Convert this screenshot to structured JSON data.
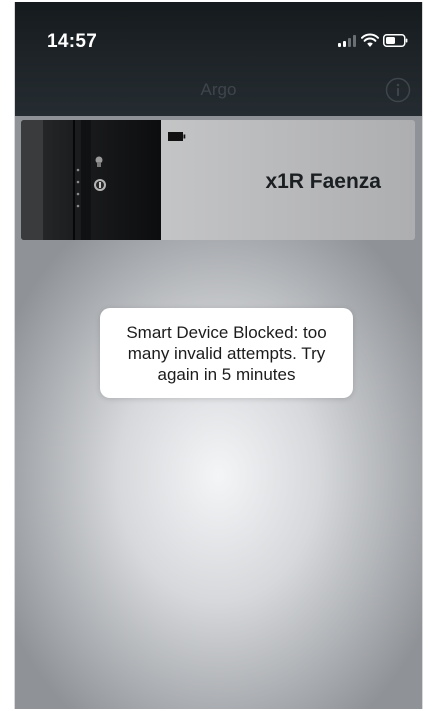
{
  "status_bar": {
    "time": "14:57",
    "signal_icon": "cellular-signal-icon",
    "wifi_icon": "wifi-icon",
    "battery_icon": "battery-icon"
  },
  "nav": {
    "title": "Argo",
    "info_icon": "info-circle-icon"
  },
  "device": {
    "name": "x1R Faenza",
    "battery_icon": "battery-small-icon",
    "image": "door-lock-image"
  },
  "toast": {
    "message": "Smart Device Blocked: too many invalid attempts. Try again in 5 minutes"
  },
  "colors": {
    "header_bg": "#1d2327",
    "nav_title": "#3e464c",
    "toast_bg": "#ffffff",
    "device_name": "#1b1f22"
  }
}
